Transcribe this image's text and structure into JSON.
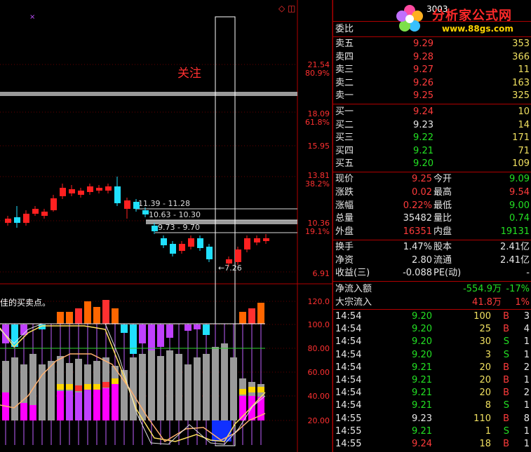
{
  "chart": {
    "top_icons": "◇ ◫",
    "cross_mark": "×",
    "annotation": "关注",
    "indicator_label": "佳的买卖点。",
    "price_axis": [
      "21.54",
      "80.9%",
      "18.09",
      "61.8%",
      "15.95",
      "13.81",
      "38.2%",
      "10.36",
      "19.1%",
      "6.91"
    ],
    "indicator_axis": [
      "120.0",
      "100.0",
      "80.00",
      "60.00",
      "40.00",
      "20.00"
    ],
    "fib_boxes": [
      "11.39 - 11.28",
      "10.63 - 10.30",
      "9.73 - 9.70"
    ],
    "low_label": "←7.26",
    "colors": {
      "up": "#ff2020",
      "down": "#20e0ff",
      "axis": "#c00000"
    }
  },
  "logo": {
    "code": "3003",
    "title": "分析家公式网",
    "url": "www.88gs.com"
  },
  "quotes": {
    "webi_label": "委比",
    "sell": [
      {
        "label": "卖五",
        "price": "9.29",
        "vol": "353"
      },
      {
        "label": "卖四",
        "price": "9.28",
        "vol": "366"
      },
      {
        "label": "卖三",
        "price": "9.27",
        "vol": "11"
      },
      {
        "label": "卖二",
        "price": "9.26",
        "vol": "163"
      },
      {
        "label": "卖一",
        "price": "9.25",
        "vol": "325"
      }
    ],
    "buy": [
      {
        "label": "买一",
        "price": "9.24",
        "vol": "10",
        "pc": "red"
      },
      {
        "label": "买二",
        "price": "9.23",
        "vol": "14",
        "pc": "white"
      },
      {
        "label": "买三",
        "price": "9.22",
        "vol": "171",
        "pc": "green"
      },
      {
        "label": "买四",
        "price": "9.21",
        "vol": "71",
        "pc": "green"
      },
      {
        "label": "买五",
        "price": "9.20",
        "vol": "109",
        "pc": "green"
      }
    ],
    "stats": [
      {
        "l1": "现价",
        "v1": "9.25",
        "c1": "red",
        "l2": "今开",
        "v2": "9.09",
        "c2": "green"
      },
      {
        "l1": "涨跌",
        "v1": "0.02",
        "c1": "red",
        "l2": "最高",
        "v2": "9.54",
        "c2": "red"
      },
      {
        "l1": "涨幅",
        "v1": "0.22%",
        "c1": "red",
        "l2": "最低",
        "v2": "9.00",
        "c2": "green"
      },
      {
        "l1": "总量",
        "v1": "35482",
        "c1": "white",
        "l2": "量比",
        "v2": "0.74",
        "c2": "green"
      },
      {
        "l1": "外盘",
        "v1": "16351",
        "c1": "red",
        "l2": "内盘",
        "v2": "19131",
        "c2": "green"
      }
    ],
    "info": [
      {
        "l1": "换手",
        "v1": "1.47%",
        "l2": "股本",
        "v2": "2.41亿"
      },
      {
        "l1": "净资",
        "v1": "2.80",
        "l2": "流通",
        "v2": "2.41亿"
      },
      {
        "l1": "收益(三)",
        "v1": "-0.088",
        "l2": "PE(动)",
        "v2": "-"
      }
    ],
    "flow": [
      {
        "label": "净流入额",
        "value": "-554.9万",
        "pct": "-17%",
        "color": "green"
      },
      {
        "label": "大宗流入",
        "value": "41.8万",
        "pct": "1%",
        "color": "red"
      }
    ],
    "ticks": [
      {
        "time": "14:54",
        "price": "9.20",
        "pc": "green",
        "vol": "100",
        "side": "B",
        "sc": "red",
        "n": "3"
      },
      {
        "time": "14:54",
        "price": "9.20",
        "pc": "green",
        "vol": "25",
        "side": "B",
        "sc": "red",
        "n": "4"
      },
      {
        "time": "14:54",
        "price": "9.20",
        "pc": "green",
        "vol": "30",
        "side": "S",
        "sc": "green",
        "n": "1"
      },
      {
        "time": "14:54",
        "price": "9.20",
        "pc": "green",
        "vol": "3",
        "side": "S",
        "sc": "green",
        "n": "1"
      },
      {
        "time": "14:54",
        "price": "9.21",
        "pc": "green",
        "vol": "20",
        "side": "B",
        "sc": "red",
        "n": "2"
      },
      {
        "time": "14:54",
        "price": "9.21",
        "pc": "green",
        "vol": "20",
        "side": "B",
        "sc": "red",
        "n": "1"
      },
      {
        "time": "14:54",
        "price": "9.21",
        "pc": "green",
        "vol": "20",
        "side": "B",
        "sc": "red",
        "n": "2"
      },
      {
        "time": "14:54",
        "price": "9.21",
        "pc": "green",
        "vol": "8",
        "side": "S",
        "sc": "green",
        "n": "1"
      },
      {
        "time": "14:55",
        "price": "9.23",
        "pc": "white",
        "vol": "110",
        "side": "B",
        "sc": "red",
        "n": "8"
      },
      {
        "time": "14:55",
        "price": "9.21",
        "pc": "green",
        "vol": "1",
        "side": "S",
        "sc": "green",
        "n": "1"
      },
      {
        "time": "14:55",
        "price": "9.24",
        "pc": "red",
        "vol": "18",
        "side": "B",
        "sc": "red",
        "n": "1"
      }
    ]
  }
}
